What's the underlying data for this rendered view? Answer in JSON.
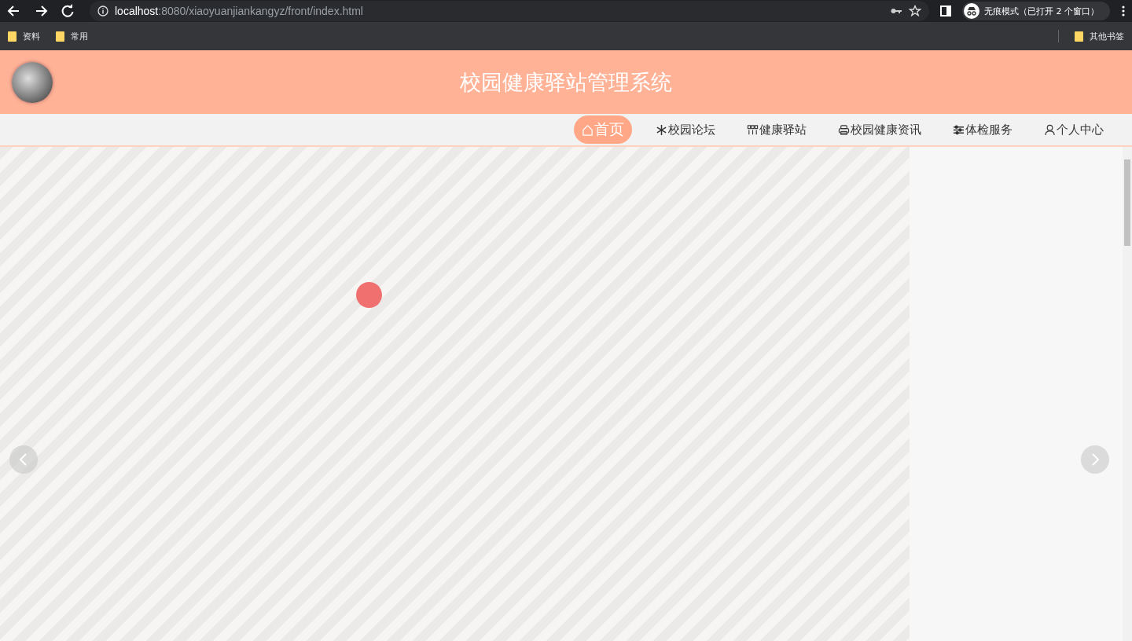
{
  "browser": {
    "url": {
      "host": "localhost",
      "path": ":8080/xiaoyuanjiankangyz/front/index.html"
    },
    "profile": "无痕模式（已打开 2 个窗口）",
    "bookmarks": [
      "资料",
      "常用"
    ],
    "other_bookmarks": "其他书签"
  },
  "header": {
    "title": "校园健康驿站管理系统"
  },
  "nav": [
    {
      "label": "首页",
      "selected": true
    },
    {
      "label": "校园论坛",
      "selected": false
    },
    {
      "label": "健康驿站",
      "selected": false
    },
    {
      "label": "校园健康资讯",
      "selected": false
    },
    {
      "label": "体检服务",
      "selected": false
    },
    {
      "label": "个人中心",
      "selected": false
    }
  ]
}
